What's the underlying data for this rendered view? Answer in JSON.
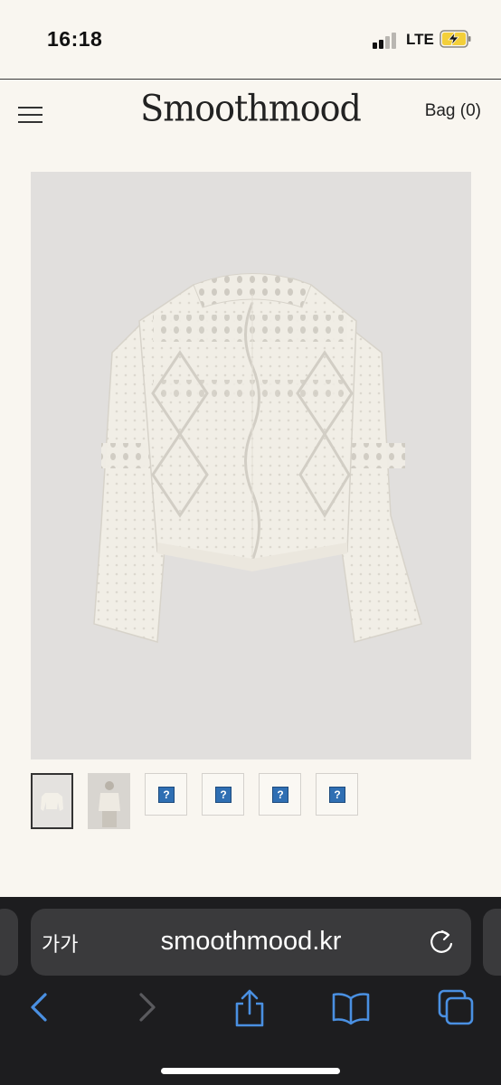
{
  "status_bar": {
    "time": "16:18",
    "network": "LTE"
  },
  "header": {
    "brand": "Smoothmood",
    "bag_label": "Bag (0)"
  },
  "product": {
    "image_icon": "white-knit-cardigan-photo",
    "thumbnail_count": 6,
    "selected_thumbnail": 1
  },
  "safari": {
    "text_size_label": "가가",
    "url": "smoothmood.kr"
  },
  "colors": {
    "background": "#f9f6f0",
    "safari_bar": "#1d1d1f",
    "safari_accent": "#4a90e2",
    "image_bg": "#e1dfdd"
  }
}
